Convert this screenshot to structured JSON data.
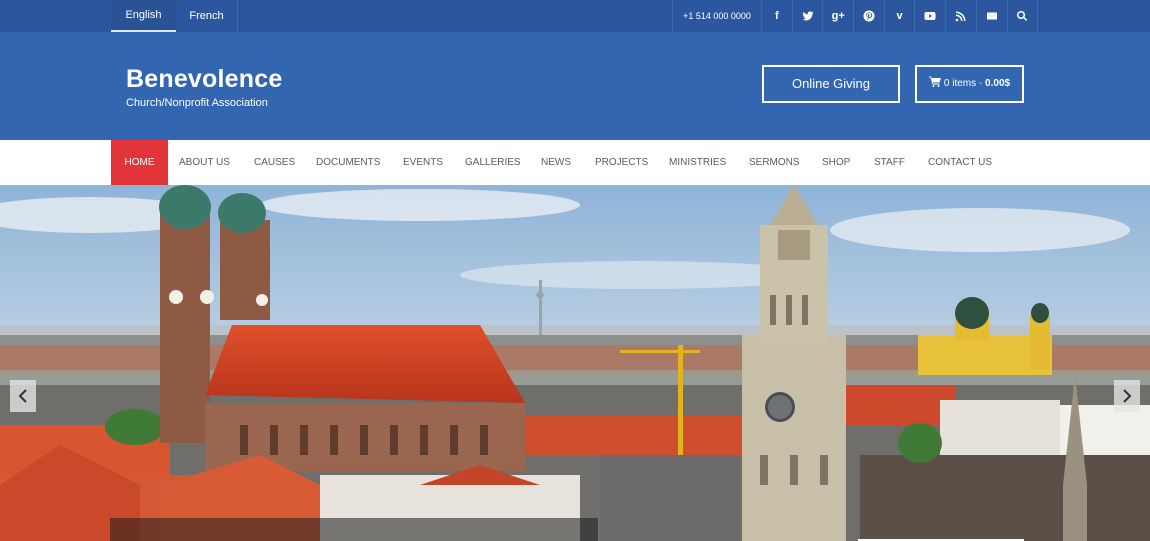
{
  "topbar": {
    "languages": [
      "English",
      "French"
    ],
    "phone": "+1 514 000 0000",
    "social": [
      {
        "icon": "facebook-icon",
        "glyph": "f"
      },
      {
        "icon": "twitter-icon",
        "glyph": ""
      },
      {
        "icon": "google-plus-icon",
        "glyph": "g+"
      },
      {
        "icon": "pinterest-icon",
        "glyph": ""
      },
      {
        "icon": "vimeo-icon",
        "glyph": "v"
      },
      {
        "icon": "youtube-icon",
        "glyph": ""
      },
      {
        "icon": "rss-icon",
        "glyph": ""
      },
      {
        "icon": "mail-icon",
        "glyph": ""
      },
      {
        "icon": "search-icon",
        "glyph": ""
      }
    ]
  },
  "header": {
    "brand": "Benevolence",
    "tagline": "Church/Nonprofit Association",
    "give_label": "Online Giving",
    "cart_items": "0 items",
    "cart_sep": "-",
    "cart_total": "0.00$"
  },
  "nav": {
    "items": [
      "HOME",
      "ABOUT US",
      "CAUSES",
      "DOCUMENTS",
      "EVENTS",
      "GALLERIES",
      "NEWS",
      "PROJECTS",
      "MINISTRIES",
      "SERMONS",
      "SHOP",
      "STAFF",
      "CONTACT US"
    ],
    "active": "HOME"
  },
  "colors": {
    "topbar": "#2c579f",
    "header": "#3266b1",
    "active_nav": "#e2353a",
    "nav_text": "#555d66"
  }
}
